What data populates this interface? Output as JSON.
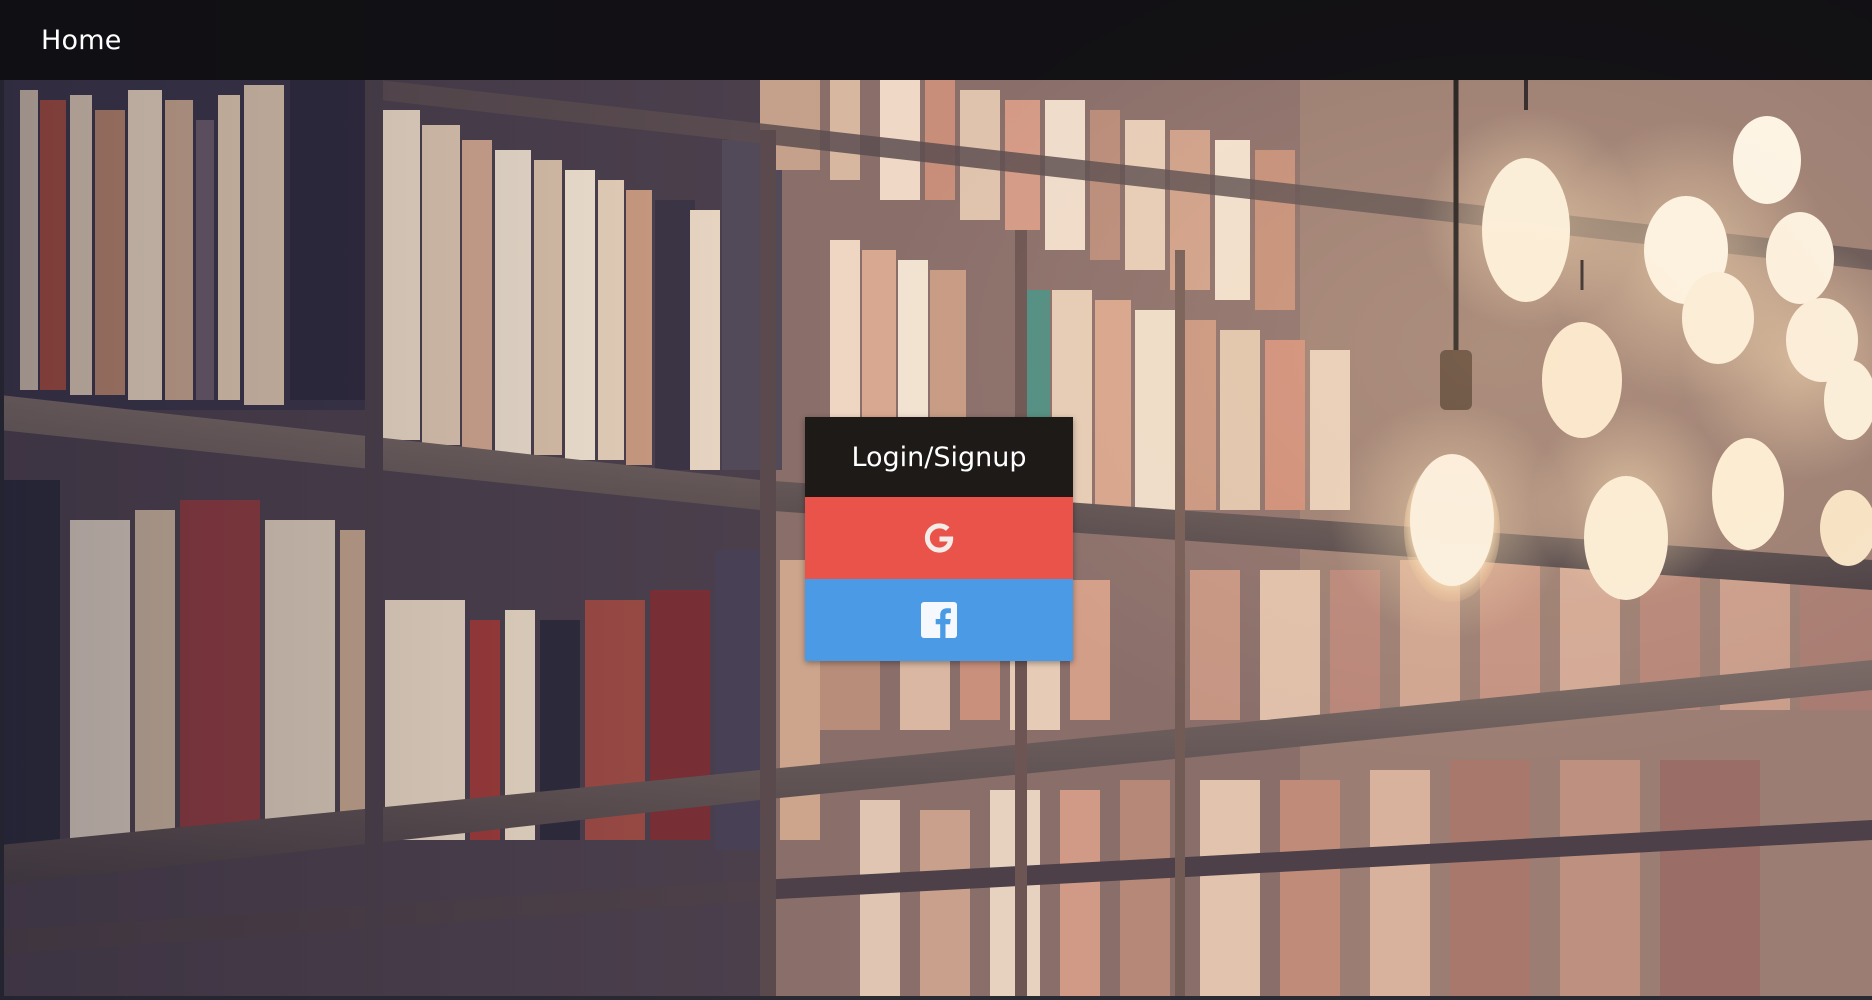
{
  "nav": {
    "home_label": "Home"
  },
  "login": {
    "title": "Login/Signup",
    "google_icon": "google-icon",
    "facebook_icon": "facebook-icon"
  },
  "colors": {
    "navbar": "#0a0a0c",
    "login_header": "#1e1a18",
    "google": "#e9534a",
    "facebook": "#4a9ae6"
  },
  "background": {
    "subject": "library-bookshelf-with-hanging-lightbulbs"
  }
}
